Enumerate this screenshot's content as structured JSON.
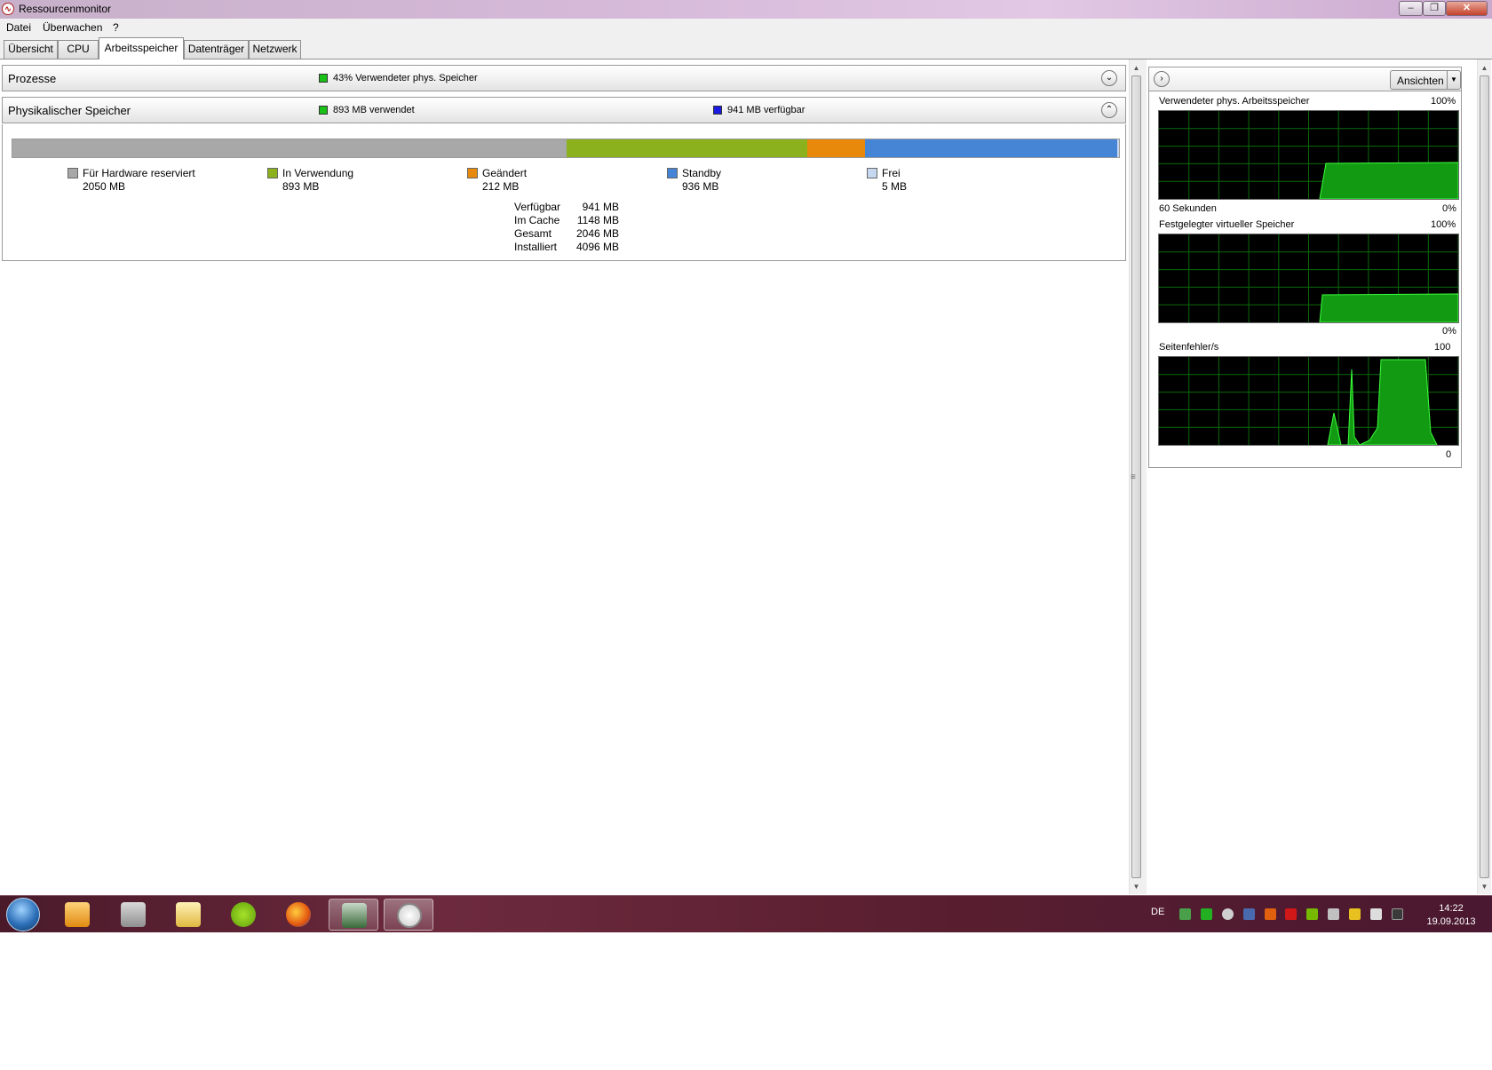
{
  "window": {
    "title": "Ressourcenmonitor"
  },
  "menu": {
    "items": [
      "Datei",
      "Überwachen",
      "?"
    ]
  },
  "tabs": [
    "Übersicht",
    "CPU",
    "Arbeitsspeicher",
    "Datenträger",
    "Netzwerk"
  ],
  "active_tab": "Arbeitsspeicher",
  "processes": {
    "title": "Prozesse",
    "status_text": "43% Verwendeter phys. Speicher",
    "status_color": "#18c018"
  },
  "physical": {
    "title": "Physikalischer Speicher",
    "used_text": "893 MB verwendet",
    "used_color": "#18c018",
    "available_text": "941 MB verfügbar",
    "available_color": "#1a1ae0",
    "bar": [
      {
        "label": "Für Hardware reserviert",
        "value": "2050 MB",
        "mb": 2050,
        "color": "#a8a8a8"
      },
      {
        "label": "In Verwendung",
        "value": "893 MB",
        "mb": 893,
        "color": "#8bb21c"
      },
      {
        "label": "Geändert",
        "value": "212 MB",
        "mb": 212,
        "color": "#e8890c"
      },
      {
        "label": "Standby",
        "value": "936 MB",
        "mb": 936,
        "color": "#4685d6"
      },
      {
        "label": "Frei",
        "value": "5 MB",
        "mb": 5,
        "color": "#c6d8f0"
      }
    ],
    "stats": [
      {
        "label": "Verfügbar",
        "value": "941 MB"
      },
      {
        "label": "Im Cache",
        "value": "1148 MB"
      },
      {
        "label": "Gesamt",
        "value": "2046 MB"
      },
      {
        "label": "Installiert",
        "value": "4096 MB"
      }
    ]
  },
  "right_panel": {
    "views_button": "Ansichten",
    "graphs": [
      {
        "title": "Verwendeter phys. Arbeitsspeicher",
        "max": "100%",
        "bottom_left": "60 Sekunden",
        "min": "0%"
      },
      {
        "title": "Festgelegter virtueller Speicher",
        "max": "100%",
        "bottom_left": "",
        "min": "0%"
      },
      {
        "title": "Seitenfehler/s",
        "max": "100",
        "bottom_left": "",
        "min": "0"
      }
    ]
  },
  "taskbar": {
    "language": "DE",
    "time": "14:22",
    "date": "19.09.2013",
    "pinned": [
      "media-player-icon",
      "app-icon",
      "explorer-icon",
      "spotify-icon",
      "firefox-icon",
      "task-manager-icon",
      "resource-monitor-icon"
    ]
  }
}
